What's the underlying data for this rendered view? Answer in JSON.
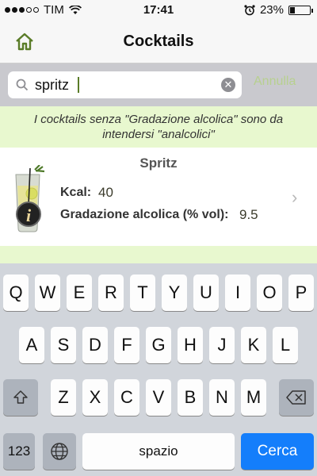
{
  "status": {
    "carrier": "TIM",
    "time": "17:41",
    "battery": "23%",
    "battery_level": 0.23
  },
  "nav": {
    "title": "Cocktails",
    "home_icon": "home-icon"
  },
  "search": {
    "value": "spritz",
    "placeholder": "",
    "cancel_label": "Annulla"
  },
  "notice": {
    "text": "I cocktails senza \"Gradazione alcolica\" sono da intendersi \"analcolici\""
  },
  "result": {
    "name": "Spritz",
    "kcal_label": "Kcal:",
    "kcal_value": "40",
    "abv_label": "Gradazione alcolica (% vol):",
    "abv_value": "9.5",
    "info_glyph": "i"
  },
  "keyboard": {
    "row1": [
      "Q",
      "W",
      "E",
      "R",
      "T",
      "Y",
      "U",
      "I",
      "O",
      "P"
    ],
    "row2": [
      "A",
      "S",
      "D",
      "F",
      "G",
      "H",
      "J",
      "K",
      "L"
    ],
    "row3": [
      "Z",
      "X",
      "C",
      "V",
      "B",
      "N",
      "M"
    ],
    "numbers_label": "123",
    "space_label": "spazio",
    "search_label": "Cerca"
  },
  "colors": {
    "accent_green": "#5a7c28",
    "notice_bg": "#e8f8cf",
    "search_key": "#147efb"
  }
}
